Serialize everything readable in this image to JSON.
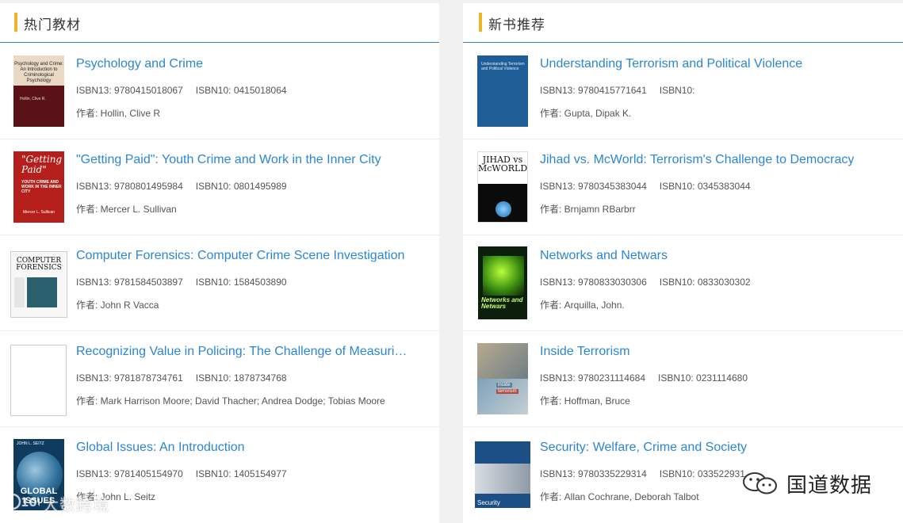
{
  "left_panel": {
    "title": "热门教材",
    "items": [
      {
        "title": "Psychology and Crime",
        "isbn13": "ISBN13: 9780415018067",
        "isbn10": "ISBN10: 0415018064",
        "author": "作者: Hollin, Clive R",
        "cover_text": "Psychology and Crime: An Introduction to Criminological Psychology",
        "cover_author": "Hollin, Clive R."
      },
      {
        "title": "\"Getting Paid\": Youth Crime and Work in the Inner City",
        "isbn13": "ISBN13: 9780801495984",
        "isbn10": "ISBN10: 0801495989",
        "author": "作者: Mercer L. Sullivan",
        "cover_text": "\"Getting Paid\"",
        "cover_sub": "YOUTH CRIME AND WORK IN THE INNER CITY",
        "cover_author": "Mercer L. Sullivan"
      },
      {
        "title": "Computer Forensics: Computer Crime Scene Investigation",
        "isbn13": "ISBN13: 9781584503897",
        "isbn10": "ISBN10: 1584503890",
        "author": "作者: John R Vacca",
        "cover_text": "COMPUTER FORENSICS"
      },
      {
        "title": "Recognizing Value in Policing: The Challenge of Measuring…",
        "isbn13": "ISBN13: 9781878734761",
        "isbn10": "ISBN10: 1878734768",
        "author": "作者: Mark Harrison Moore; David Thacher; Andrea Dodge; Tobias Moore"
      },
      {
        "title": "Global Issues: An Introduction",
        "isbn13": "ISBN13: 9781405154970",
        "isbn10": "ISBN10: 1405154977",
        "author": "作者: John L. Seitz",
        "cover_top": "JOHN L. SEITZ",
        "cover_text": "GLOBAL ISSUES"
      }
    ]
  },
  "right_panel": {
    "title": "新书推荐",
    "items": [
      {
        "title": "Understanding Terrorism and Political Violence",
        "isbn13": "ISBN13: 9780415771641",
        "isbn10": "ISBN10:",
        "author": "作者: Gupta, Dipak K.",
        "cover_text": "Understanding Terrorism and Political Violence"
      },
      {
        "title": "Jihad vs. McWorld: Terrorism's Challenge to Democracy",
        "isbn13": "ISBN13: 9780345383044",
        "isbn10": "ISBN10: 0345383044",
        "author": "作者: Brnjamn RBarbrr",
        "cover_text": "JIHAD vs McWORLD"
      },
      {
        "title": "Networks and Netwars",
        "isbn13": "ISBN13: 9780833030306",
        "isbn10": "ISBN10: 0833030302",
        "author": "作者: Arquilla, John.",
        "cover_text": "Networks and Netwars"
      },
      {
        "title": "Inside Terrorism",
        "isbn13": "ISBN13: 9780231114684",
        "isbn10": "ISBN10: 0231114680",
        "author": "作者: Hoffman, Bruce",
        "cover_text": "inside",
        "cover_text2": "terrorism"
      },
      {
        "title": "Security: Welfare, Crime and Society",
        "isbn13": "ISBN13: 9780335229314",
        "isbn10": "ISBN10: 033522931",
        "author": "作者: Allan Cochrane, Deborah Talbot",
        "cover_text": "Security"
      }
    ]
  },
  "watermarks": {
    "right": "国道数据",
    "right_icon": "wechat-icon",
    "left": "大数跨境",
    "left_icon": "logo-100-icon"
  },
  "colors": {
    "link": "#2b86d3",
    "accent_bar": "#f0b429",
    "header_rule": "#2e7fc5"
  }
}
